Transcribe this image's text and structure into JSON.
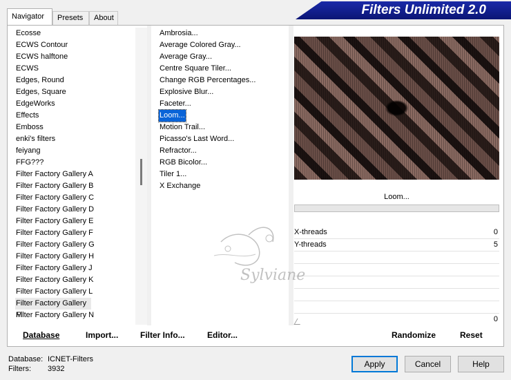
{
  "tabs": [
    "Navigator",
    "Presets",
    "About"
  ],
  "banner": "Filters Unlimited 2.0",
  "categories": [
    "Ecosse",
    "ECWS Contour",
    "ECWS halftone",
    "ECWS",
    "Edges, Round",
    "Edges, Square",
    "EdgeWorks",
    "Effects",
    "Emboss",
    "enki's filters",
    "feiyang",
    "FFG???",
    "Filter Factory Gallery A",
    "Filter Factory Gallery B",
    "Filter Factory Gallery C",
    "Filter Factory Gallery D",
    "Filter Factory Gallery E",
    "Filter Factory Gallery F",
    "Filter Factory Gallery G",
    "Filter Factory Gallery H",
    "Filter Factory Gallery J",
    "Filter Factory Gallery K",
    "Filter Factory Gallery L",
    "Filter Factory Gallery M",
    "Filter Factory Gallery N"
  ],
  "selected_category": "Filter Factory Gallery M",
  "filters": [
    "Ambrosia...",
    "Average Colored Gray...",
    "Average Gray...",
    "Centre Square Tiler...",
    "Change RGB Percentages...",
    "Explosive Blur...",
    "Faceter...",
    "Loom...",
    "Motion Trail...",
    "Picasso's Last Word...",
    "Refractor...",
    "RGB Bicolor...",
    "Tiler 1...",
    "X Exchange"
  ],
  "selected_filter": "Loom...",
  "filter_name": "Loom...",
  "progress": 0,
  "params": [
    {
      "label": "X-threads",
      "value": "0"
    },
    {
      "label": "Y-threads",
      "value": "5"
    }
  ],
  "extra_value": "0",
  "watermark": "Sylviane",
  "toolbar": {
    "database": "Database",
    "import": "Import...",
    "filter_info": "Filter Info...",
    "editor": "Editor...",
    "randomize": "Randomize",
    "reset": "Reset"
  },
  "status": {
    "database_label": "Database:",
    "database_value": "ICNET-Filters",
    "filters_label": "Filters:",
    "filters_value": "3932"
  },
  "buttons": {
    "apply": "Apply",
    "cancel": "Cancel",
    "help": "Help"
  }
}
